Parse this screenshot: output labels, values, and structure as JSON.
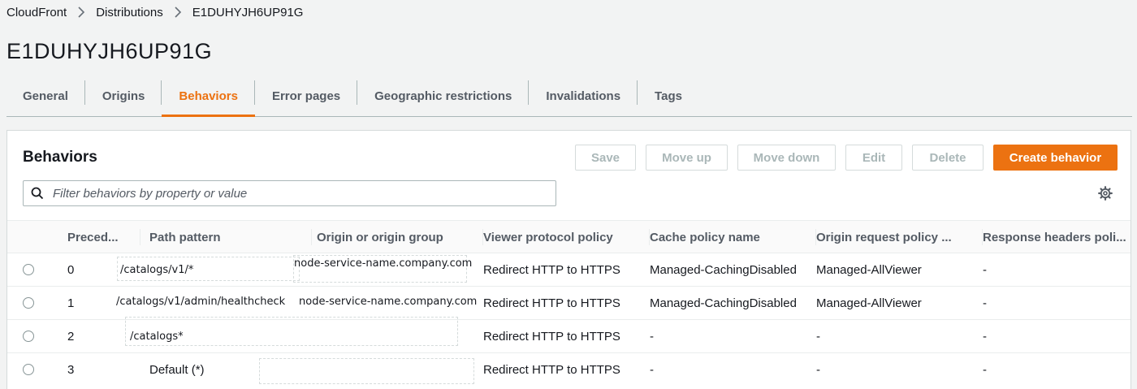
{
  "breadcrumb": {
    "items": [
      "CloudFront",
      "Distributions",
      "E1DUHYJH6UP91G"
    ]
  },
  "page": {
    "title": "E1DUHYJH6UP91G"
  },
  "tabs": [
    "General",
    "Origins",
    "Behaviors",
    "Error pages",
    "Geographic restrictions",
    "Invalidations",
    "Tags"
  ],
  "active_tab": "Behaviors",
  "panel": {
    "title": "Behaviors",
    "buttons": {
      "save": "Save",
      "move_up": "Move up",
      "move_down": "Move down",
      "edit": "Edit",
      "delete": "Delete",
      "create": "Create behavior"
    },
    "search_placeholder": "Filter behaviors by property or value"
  },
  "table": {
    "headers": [
      "Preced...",
      "Path pattern",
      "Origin or origin group",
      "Viewer protocol policy",
      "Cache policy name",
      "Origin request policy ...",
      "Response headers poli..."
    ],
    "rows": [
      {
        "precedence": "0",
        "path": "/catalogs/v1/*",
        "origin": "node-service-name.company.com",
        "viewer": "Redirect HTTP to HTTPS",
        "cache": "Managed-CachingDisabled",
        "origin_request": "Managed-AllViewer",
        "response_headers": "-"
      },
      {
        "precedence": "1",
        "path": "/catalogs/v1/admin/healthcheck",
        "origin": "node-service-name.company.com",
        "viewer": "Redirect HTTP to HTTPS",
        "cache": "Managed-CachingDisabled",
        "origin_request": "Managed-AllViewer",
        "response_headers": "-"
      },
      {
        "precedence": "2",
        "path": "/catalogs*",
        "origin": "",
        "viewer": "Redirect HTTP to HTTPS",
        "cache": "-",
        "origin_request": "-",
        "response_headers": "-"
      },
      {
        "precedence": "3",
        "path": "Default (*)",
        "origin": "",
        "viewer": "Redirect HTTP to HTTPS",
        "cache": "-",
        "origin_request": "-",
        "response_headers": "-"
      }
    ]
  },
  "icons": {
    "search": "search-icon",
    "settings": "gear-icon",
    "separator": "chevron-right-icon"
  },
  "colors": {
    "accent": "#ec7211",
    "text": "#16191f",
    "muted": "#545b64",
    "disabled": "#aab7b8",
    "background": "#f2f3f3"
  }
}
